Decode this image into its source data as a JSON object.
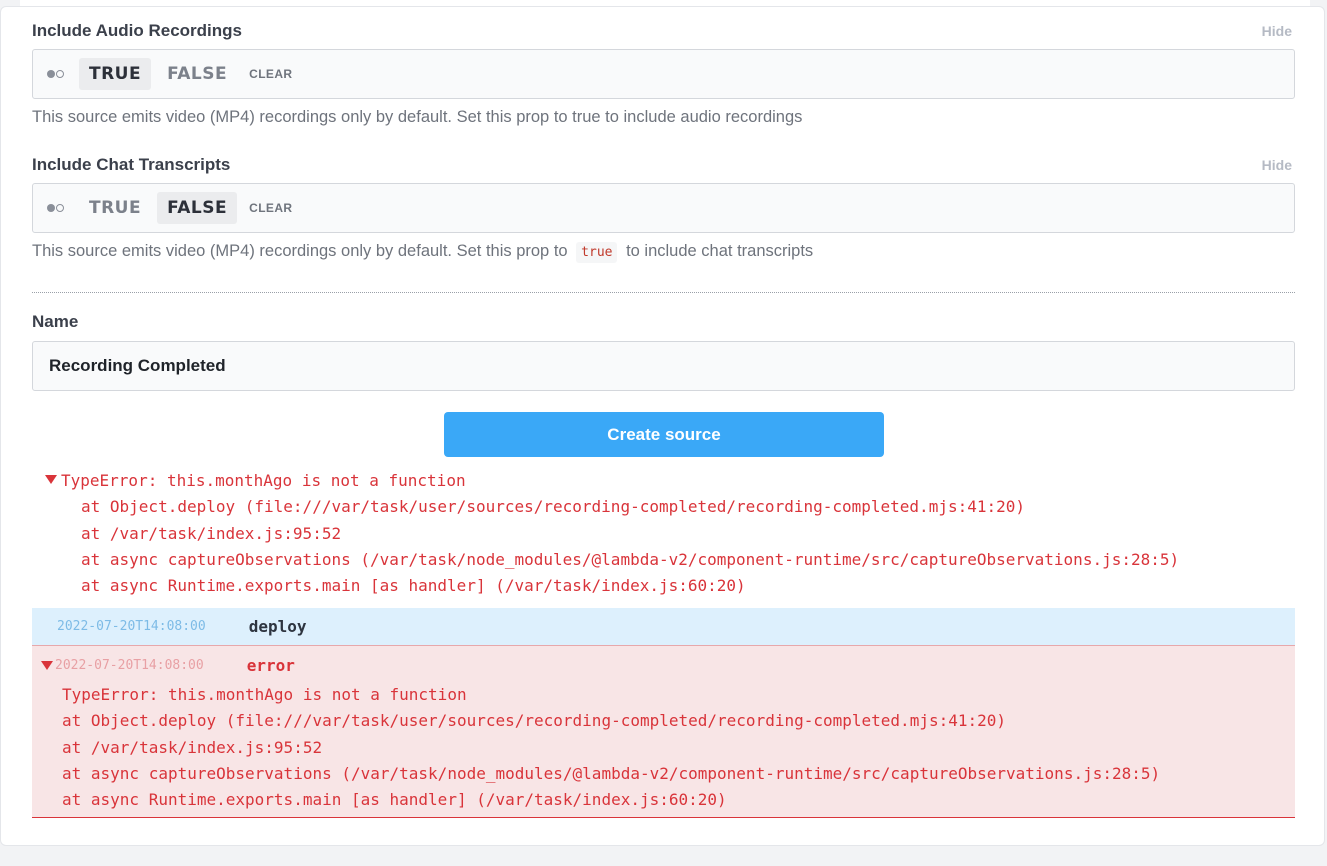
{
  "audio": {
    "label": "Include Audio Recordings",
    "hide": "Hide",
    "option_true": "TRUE",
    "option_false": "FALSE",
    "clear": "CLEAR",
    "selected": "TRUE",
    "help": "This source emits video (MP4) recordings only by default. Set this prop to true to include audio recordings"
  },
  "chat": {
    "label": "Include Chat Transcripts",
    "hide": "Hide",
    "option_true": "TRUE",
    "option_false": "FALSE",
    "clear": "CLEAR",
    "selected": "FALSE",
    "help_before": "This source emits video (MP4) recordings only by default. Set this prop to",
    "help_code": "true",
    "help_after": "to include chat transcripts"
  },
  "name_field": {
    "label": "Name",
    "value": "Recording Completed"
  },
  "create_button": "Create source",
  "error_trace": {
    "title": "TypeError: this.monthAgo is not a function",
    "lines": [
      "at Object.deploy (file:///var/task/user/sources/recording-completed/recording-completed.mjs:41:20)",
      "at /var/task/index.js:95:52",
      "at async captureObservations (/var/task/node_modules/@lambda-v2/component-runtime/src/captureObservations.js:28:5)",
      "at async Runtime.exports.main [as handler] (/var/task/index.js:60:20)"
    ]
  },
  "logs": [
    {
      "timestamp": "2022-07-20T14:08:00",
      "kind": "deploy"
    },
    {
      "timestamp": "2022-07-20T14:08:00",
      "kind": "error",
      "lines": [
        "TypeError: this.monthAgo is not a function",
        "at Object.deploy (file:///var/task/user/sources/recording-completed/recording-completed.mjs:41:20)",
        "at /var/task/index.js:95:52",
        "at async captureObservations (/var/task/node_modules/@lambda-v2/component-runtime/src/captureObservations.js:28:5)",
        "at async Runtime.exports.main [as handler] (/var/task/index.js:60:20)"
      ]
    }
  ],
  "colors": {
    "primary_button": "#3aa8f7",
    "error_text": "#d9343a",
    "deploy_row_bg": "#ddf0fd",
    "error_row_bg": "#f8e5e6"
  },
  "icons": {
    "toggle": "boolean-toggle-icon",
    "expand": "caret-down-icon"
  }
}
